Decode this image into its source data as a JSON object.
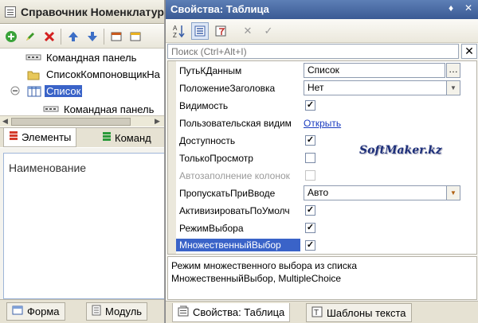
{
  "left_window": {
    "title": "Справочник Номенклатура",
    "toolbar": {
      "icons": [
        "add-icon",
        "edit-icon",
        "delete-icon",
        "move-up-icon",
        "move-down-icon",
        "form-icon"
      ]
    },
    "tree": [
      {
        "label": "Командная панель",
        "icon": "command-panel-icon"
      },
      {
        "label": "СписокКомпоновщикНа",
        "icon": "folder-icon"
      },
      {
        "label": "Список",
        "icon": "table-icon",
        "selected": true
      },
      {
        "label": "Командная панель",
        "icon": "command-panel-icon"
      }
    ],
    "tabs": [
      {
        "label": "Элементы",
        "icon": "elements-icon",
        "active": true
      },
      {
        "label": "Команд",
        "icon": "commands-icon",
        "active": false
      }
    ],
    "column_header": "Наименование",
    "bottom_tabs": [
      {
        "label": "Форма",
        "icon": "form-icon"
      },
      {
        "label": "Модуль",
        "icon": "module-icon"
      }
    ]
  },
  "right_panel": {
    "title": "Свойства: Таблица",
    "title_controls": [
      "pin-icon",
      "close-icon"
    ],
    "search_placeholder": "Поиск (Ctrl+Alt+I)",
    "properties": [
      {
        "name": "ПутьКДанным",
        "kind": "text-ellipsis",
        "value": "Список"
      },
      {
        "name": "ПоложениеЗаголовка",
        "kind": "dropdown",
        "value": "Нет"
      },
      {
        "name": "Видимость",
        "kind": "checkbox",
        "checked": true
      },
      {
        "name": "Пользовательская видим",
        "kind": "link",
        "value": "Открыть"
      },
      {
        "name": "Доступность",
        "kind": "checkbox",
        "checked": true
      },
      {
        "name": "ТолькоПросмотр",
        "kind": "checkbox",
        "checked": false
      },
      {
        "name": "Автозаполнение колонок",
        "kind": "checkbox",
        "checked": false,
        "disabled": true
      },
      {
        "name": "ПропускатьПриВводе",
        "kind": "dropdown",
        "value": "Авто"
      },
      {
        "name": "АктивизироватьПоУмолч",
        "kind": "checkbox",
        "checked": true
      },
      {
        "name": "РежимВыбора",
        "kind": "checkbox",
        "checked": true
      },
      {
        "name": "МножественныйВыбор",
        "kind": "checkbox",
        "checked": true,
        "selected": true
      }
    ],
    "watermark": "SoftMaker.kz",
    "description_line1": "Режим множественного выбора из списка",
    "description_line2": "МножественныйВыбор, MultipleChoice",
    "bottom_tabs": [
      {
        "label": "Свойства: Таблица",
        "icon": "properties-icon",
        "active": true
      },
      {
        "label": "Шаблоны текста",
        "icon": "templates-icon",
        "active": false
      }
    ]
  }
}
